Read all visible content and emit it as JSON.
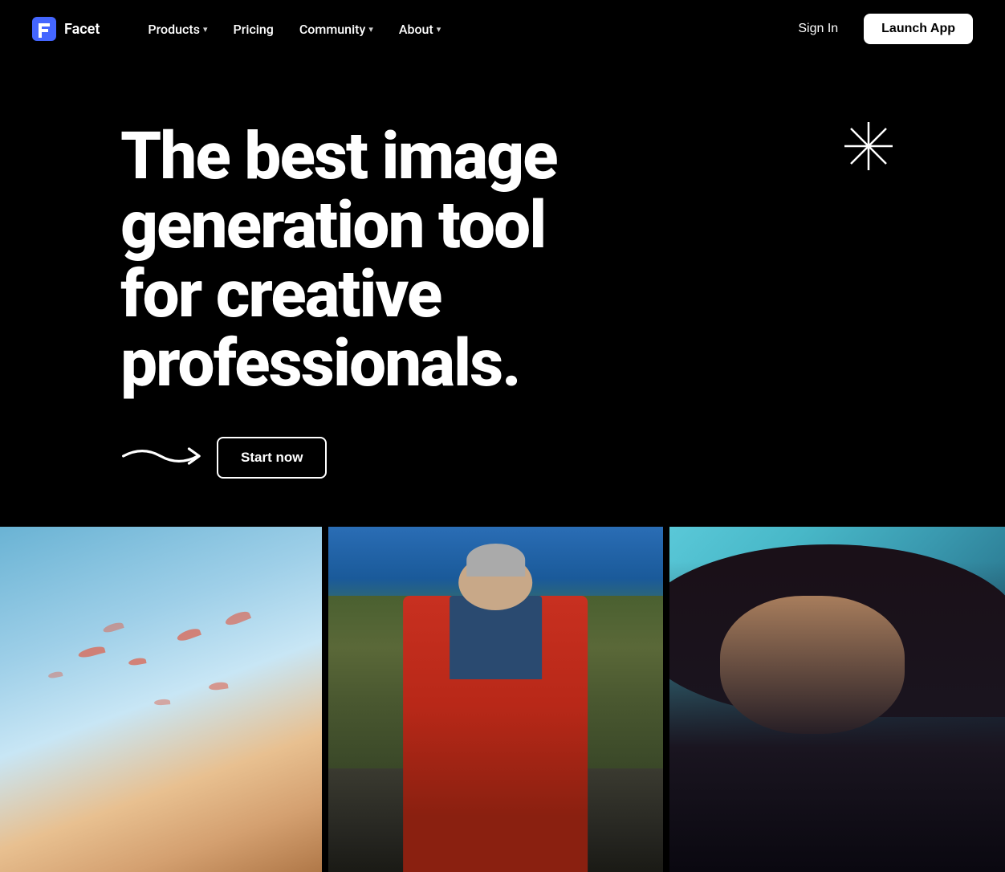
{
  "brand": {
    "name": "Facet",
    "logo_icon": "F"
  },
  "nav": {
    "items": [
      {
        "label": "Products",
        "has_dropdown": true,
        "id": "products"
      },
      {
        "label": "Pricing",
        "has_dropdown": false,
        "id": "pricing"
      },
      {
        "label": "Community",
        "has_dropdown": true,
        "id": "community"
      },
      {
        "label": "About",
        "has_dropdown": true,
        "id": "about"
      }
    ],
    "sign_in_label": "Sign In",
    "launch_app_label": "Launch App"
  },
  "hero": {
    "headline_line1": "The best image generation tool",
    "headline_line2": "for creative professionals.",
    "cta_label": "Start now"
  },
  "gallery": {
    "images": [
      {
        "id": "sky-birds",
        "alt": "Sky with birds"
      },
      {
        "id": "man-red-jacket",
        "alt": "Man in red jacket"
      },
      {
        "id": "portrait",
        "alt": "Portrait"
      }
    ]
  }
}
